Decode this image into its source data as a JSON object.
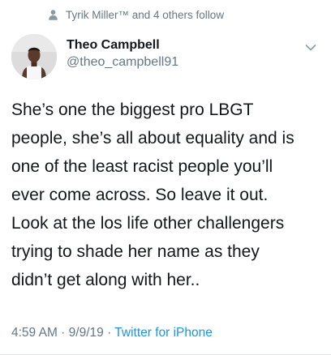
{
  "social_context": {
    "text": "Tyrik Miller™ and 4 others follow",
    "icon": "person-icon"
  },
  "author": {
    "display_name": "Theo Campbell",
    "handle": "@theo_campbell91",
    "avatar_icon": "avatar-photo"
  },
  "tweet": {
    "lines": [
      "She’s one the biggest pro LBGT",
      "people, she’s all about equality and is",
      "one of the least racist people you’ll",
      "ever come across. So leave it out.",
      "Look at the los life other challengers",
      "trying to shade her name as they",
      "didn’t get along with her.."
    ]
  },
  "meta": {
    "time": "4:59 AM",
    "separator": " · ",
    "date": "9/9/19",
    "source": "Twitter for iPhone"
  },
  "colors": {
    "text": "#14171a",
    "secondary": "#657786",
    "link": "#1b95e0"
  }
}
